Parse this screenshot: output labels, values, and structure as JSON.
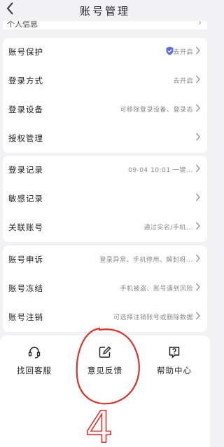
{
  "header": {
    "back_icon": "chevron-left-icon",
    "title": "账号管理"
  },
  "peek_row": {
    "label": "个人信息"
  },
  "group1": [
    {
      "label": "账号保护",
      "value": "去开启",
      "icon": "shield-check-icon"
    },
    {
      "label": "登录方式",
      "value": "去开启"
    },
    {
      "label": "登录设备",
      "value": "可移除登录设备、登录态"
    },
    {
      "label": "授权管理",
      "value": ""
    }
  ],
  "group2": [
    {
      "label": "登录记录",
      "value": "09-04 10:01 一键..."
    },
    {
      "label": "敏感记录",
      "value": ""
    },
    {
      "label": "关联账号",
      "value": "通过实名/手机..."
    }
  ],
  "group3": [
    {
      "label": "账号申诉",
      "value": "登录异常、手机停用、解封呀..."
    },
    {
      "label": "账号冻结",
      "value": "手机被盗、账号遇到风险"
    },
    {
      "label": "账号注销",
      "value": "可选择注销账号或删除数据"
    }
  ],
  "bottom_tools": [
    {
      "label": "找回客服",
      "icon": "headset-icon"
    },
    {
      "label": "意见反馈",
      "icon": "edit-icon"
    },
    {
      "label": "帮助中心",
      "icon": "help-icon"
    }
  ],
  "annotation": {
    "color": "#d9342b",
    "mark": "4"
  }
}
